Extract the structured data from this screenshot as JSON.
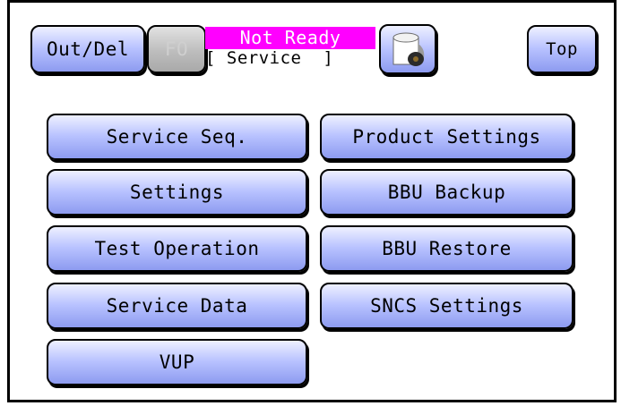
{
  "header": {
    "out_del_label": "Out/Del",
    "disabled_label": "FO",
    "status_text": "Not Ready",
    "mode_text": "[ Service  ]",
    "top_label": "Top",
    "icon": "paper-roll-icon"
  },
  "menu": {
    "service_seq": "Service Seq.",
    "product_settings": "Product Settings",
    "settings": "Settings",
    "bbu_backup": "BBU Backup",
    "test_operation": "Test Operation",
    "bbu_restore": "BBU Restore",
    "service_data": "Service Data",
    "sncs_settings": "SNCS Settings",
    "vup": "VUP"
  },
  "colors": {
    "status_background": "#ff00ff",
    "button_gradient_light": "#eef0ff",
    "button_gradient_dark": "#8d9bf0",
    "frame_border": "#000000"
  }
}
